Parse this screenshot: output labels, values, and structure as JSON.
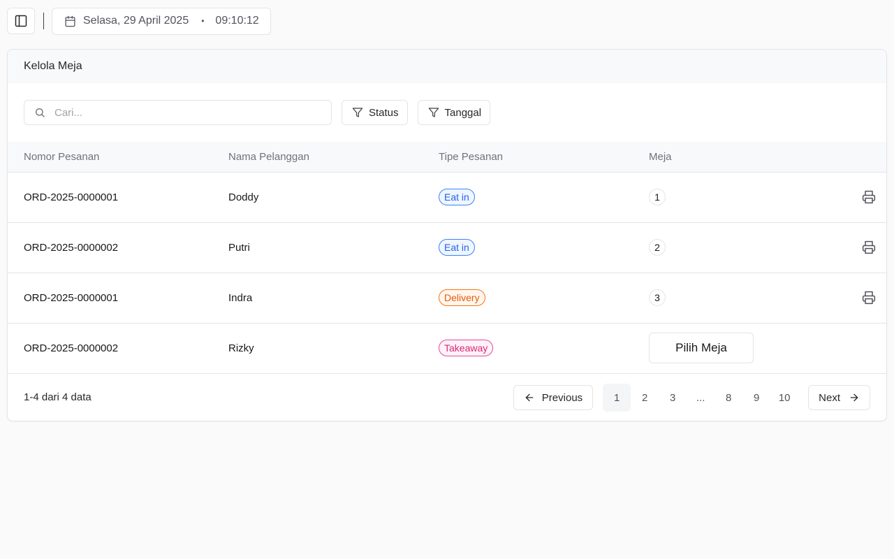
{
  "topbar": {
    "date": "Selasa, 29 April 2025",
    "separator": "•",
    "time": "09:10:12"
  },
  "card": {
    "title": "Kelola Meja"
  },
  "toolbar": {
    "search_placeholder": "Cari...",
    "filters": [
      "Status",
      "Tanggal"
    ]
  },
  "table": {
    "headers": [
      "Nomor Pesanan",
      "Nama Pelanggan",
      "Tipe Pesanan",
      "Meja"
    ],
    "rows": [
      {
        "order": "ORD-2025-0000001",
        "customer": "Doddy",
        "type": "Eat in",
        "table": "1"
      },
      {
        "order": "ORD-2025-0000002",
        "customer": "Putri",
        "type": "Eat in",
        "table": "2"
      },
      {
        "order": "ORD-2025-0000001",
        "customer": "Indra",
        "type": "Delivery",
        "table": "3"
      },
      {
        "order": "ORD-2025-0000002",
        "customer": "Rizky",
        "type": "Takeaway",
        "action": "Pilih Meja"
      }
    ]
  },
  "footer": {
    "info": "1-4 dari 4 data",
    "previous": "Previous",
    "next": "Next",
    "pages": [
      "1",
      "2",
      "3",
      "...",
      "8",
      "9",
      "10"
    ],
    "active_page": "1"
  },
  "colors": {
    "eat_in": "#2563eb",
    "delivery": "#ea580c",
    "takeaway": "#db2777"
  },
  "icons": {
    "sidebar_toggle": "panel-left-icon",
    "calendar": "calendar-icon",
    "search": "search-icon",
    "filter": "filter-icon",
    "print": "printer-icon",
    "prev": "arrow-left-icon",
    "next": "arrow-right-icon"
  }
}
